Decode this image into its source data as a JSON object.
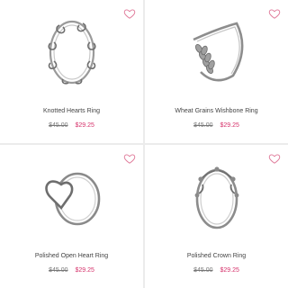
{
  "products": [
    {
      "name": "Knotted Hearts Ring",
      "original_price": "$45.00",
      "sale_price": "$29.25",
      "image": "knotted-hearts-ring"
    },
    {
      "name": "Wheat Grains Wishbone Ring",
      "original_price": "$45.00",
      "sale_price": "$29.25",
      "image": "wheat-grains-wishbone-ring"
    },
    {
      "name": "Polished Open Heart Ring",
      "original_price": "$45.00",
      "sale_price": "$29.25",
      "image": "polished-open-heart-ring"
    },
    {
      "name": "Polished Crown Ring",
      "original_price": "$45.00",
      "sale_price": "$29.25",
      "image": "polished-crown-ring"
    }
  ],
  "icons": {
    "favorite": "heart-outline-icon"
  },
  "colors": {
    "sale": "#d6336c",
    "favorite": "#e07a9a",
    "background": "#ececec"
  }
}
